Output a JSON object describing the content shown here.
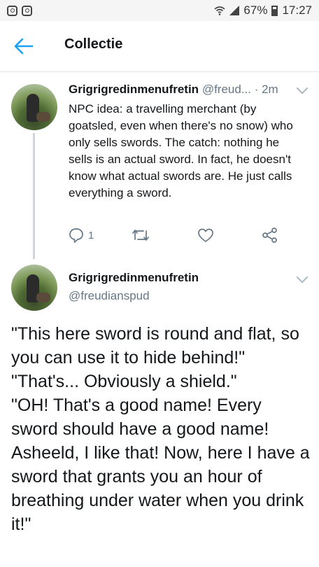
{
  "status_bar": {
    "battery": "67%",
    "time": "17:27"
  },
  "header": {
    "title": "Collectie"
  },
  "tweet1": {
    "display_name": "Grigrigredinmenufretin",
    "handle": "@freud...",
    "time": " · 2m",
    "text": "NPC idea: a travelling merchant (by goatsled, even when there's no snow) who only sells swords. The catch: nothing he sells is an actual sword. In fact, he doesn't know what actual swords are. He just calls everything a sword.",
    "reply_count": "1"
  },
  "tweet2": {
    "display_name": "Grigrigredinmenufretin",
    "handle": "@freudianspud",
    "text": "\"This here sword is round and flat, so you can use it to hide behind!\"\n\"That's... Obviously a shield.\"\n\"OH! That's a good name! Every sword should have a good name! Asheeld, I like that! Now, here I have a sword that grants you an hour of breathing under water when you drink it!\""
  },
  "colors": {
    "accent": "#1da1f2",
    "secondary_text": "#657786",
    "icon_gray": "#657786"
  },
  "icons": [
    "instagram-icon",
    "wifi-icon",
    "signal-icon",
    "battery-icon",
    "back-arrow-icon",
    "chevron-down-icon",
    "reply-icon",
    "retweet-icon",
    "like-icon",
    "share-icon"
  ]
}
